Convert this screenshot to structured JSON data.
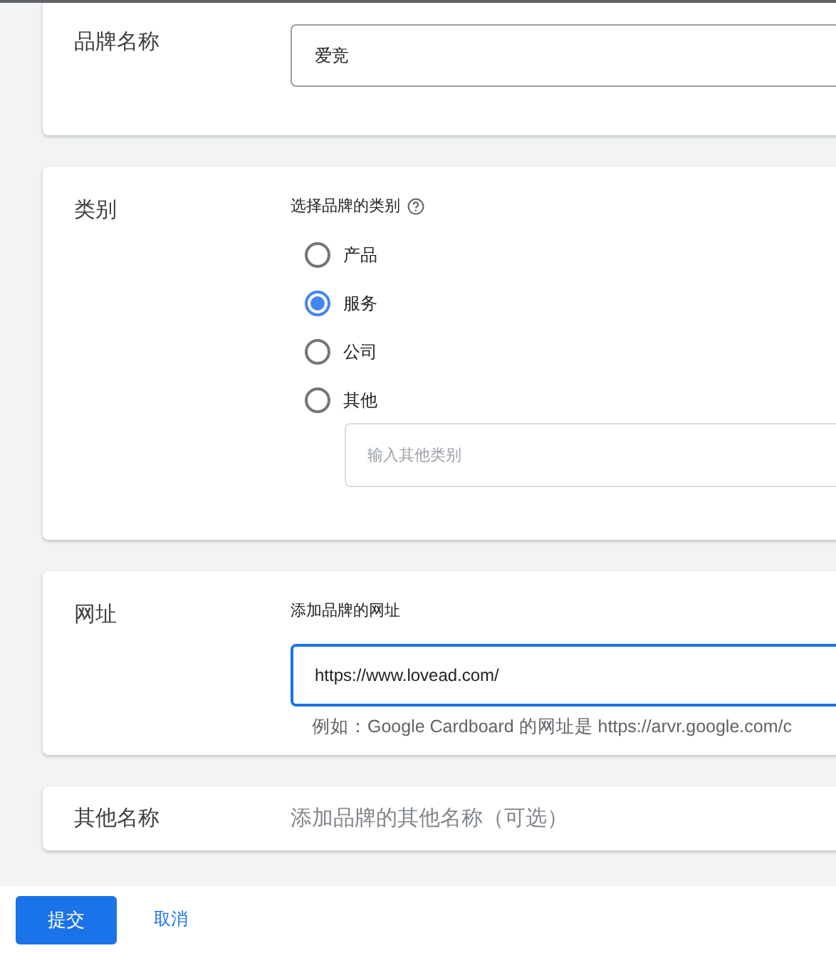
{
  "brand_name": {
    "label": "品牌名称",
    "value": "爱竞"
  },
  "category": {
    "label": "类别",
    "prompt": "选择品牌的类别",
    "options": [
      {
        "label": "产品",
        "selected": false
      },
      {
        "label": "服务",
        "selected": true
      },
      {
        "label": "公司",
        "selected": false
      },
      {
        "label": "其他",
        "selected": false
      }
    ],
    "other_placeholder": "输入其他类别"
  },
  "website": {
    "label": "网址",
    "prompt": "添加品牌的网址",
    "value": "https://www.lovead.com/",
    "focused": true,
    "hint": "例如：Google Cardboard 的网址是 https://arvr.google.com/c"
  },
  "other_names": {
    "label": "其他名称",
    "placeholder": "添加品牌的其他名称（可选）"
  },
  "buttons": {
    "submit": "提交",
    "cancel": "取消"
  }
}
